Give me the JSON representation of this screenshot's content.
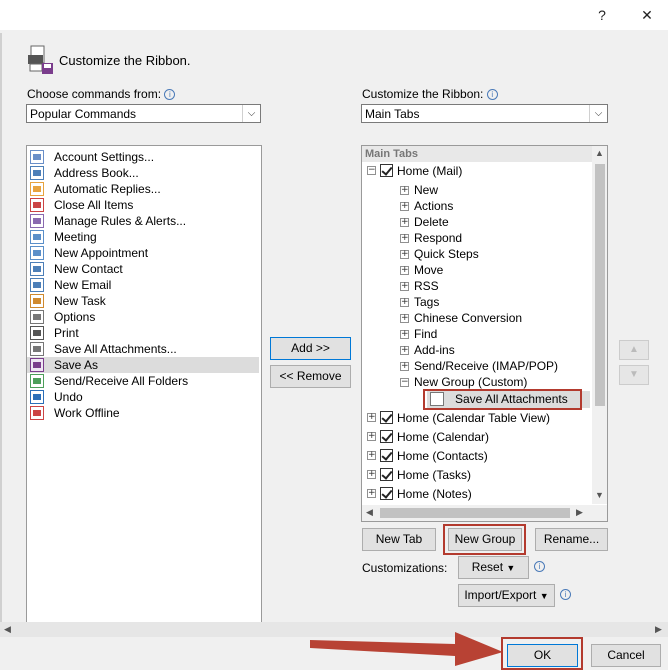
{
  "titlebar": {
    "help": "?",
    "close": "✕"
  },
  "header": {
    "title": "Customize the Ribbon."
  },
  "left": {
    "choose_label": "Choose commands from:",
    "choose_value": "Popular Commands",
    "items": [
      {
        "label": "Account Settings...",
        "icon": "account-settings-icon"
      },
      {
        "label": "Address Book...",
        "icon": "address-book-icon"
      },
      {
        "label": "Automatic Replies...",
        "icon": "automatic-replies-icon"
      },
      {
        "label": "Close All Items",
        "icon": "close-all-items-icon"
      },
      {
        "label": "Manage Rules & Alerts...",
        "icon": "manage-rules-icon"
      },
      {
        "label": "Meeting",
        "icon": "meeting-icon"
      },
      {
        "label": "New Appointment",
        "icon": "new-appointment-icon"
      },
      {
        "label": "New Contact",
        "icon": "new-contact-icon"
      },
      {
        "label": "New Email",
        "icon": "new-email-icon"
      },
      {
        "label": "New Task",
        "icon": "new-task-icon"
      },
      {
        "label": "Options",
        "icon": "options-icon"
      },
      {
        "label": "Print",
        "icon": "print-icon"
      },
      {
        "label": "Save All Attachments...",
        "icon": "paperclip-icon"
      },
      {
        "label": "Save As",
        "icon": "save-as-icon"
      },
      {
        "label": "Send/Receive All Folders",
        "icon": "send-receive-icon"
      },
      {
        "label": "Undo",
        "icon": "undo-icon"
      },
      {
        "label": "Work Offline",
        "icon": "work-offline-icon"
      }
    ]
  },
  "middle": {
    "add": "Add >>",
    "remove": "<< Remove"
  },
  "right": {
    "customize_label": "Customize the Ribbon:",
    "customize_value": "Main Tabs",
    "tree_header": "Main Tabs",
    "home_mail": "Home (Mail)",
    "groups": [
      "New",
      "Actions",
      "Delete",
      "Respond",
      "Quick Steps",
      "Move",
      "RSS",
      "Tags",
      "Chinese Conversion",
      "Find",
      "Add-ins",
      "Send/Receive (IMAP/POP)"
    ],
    "new_group": "New Group (Custom)",
    "new_group_item": "Save All Attachments",
    "tabs": [
      "Home (Calendar Table View)",
      "Home (Calendar)",
      "Home (Contacts)",
      "Home (Tasks)",
      "Home (Notes)"
    ],
    "new_tab": "New Tab",
    "new_group_btn": "New Group",
    "rename": "Rename...",
    "customizations_label": "Customizations:",
    "reset": "Reset",
    "import_export": "Import/Export"
  },
  "footer": {
    "ok": "OK",
    "cancel": "Cancel"
  },
  "colors": {
    "highlight_box": "#b33a2e",
    "arrow": "#b84234"
  }
}
